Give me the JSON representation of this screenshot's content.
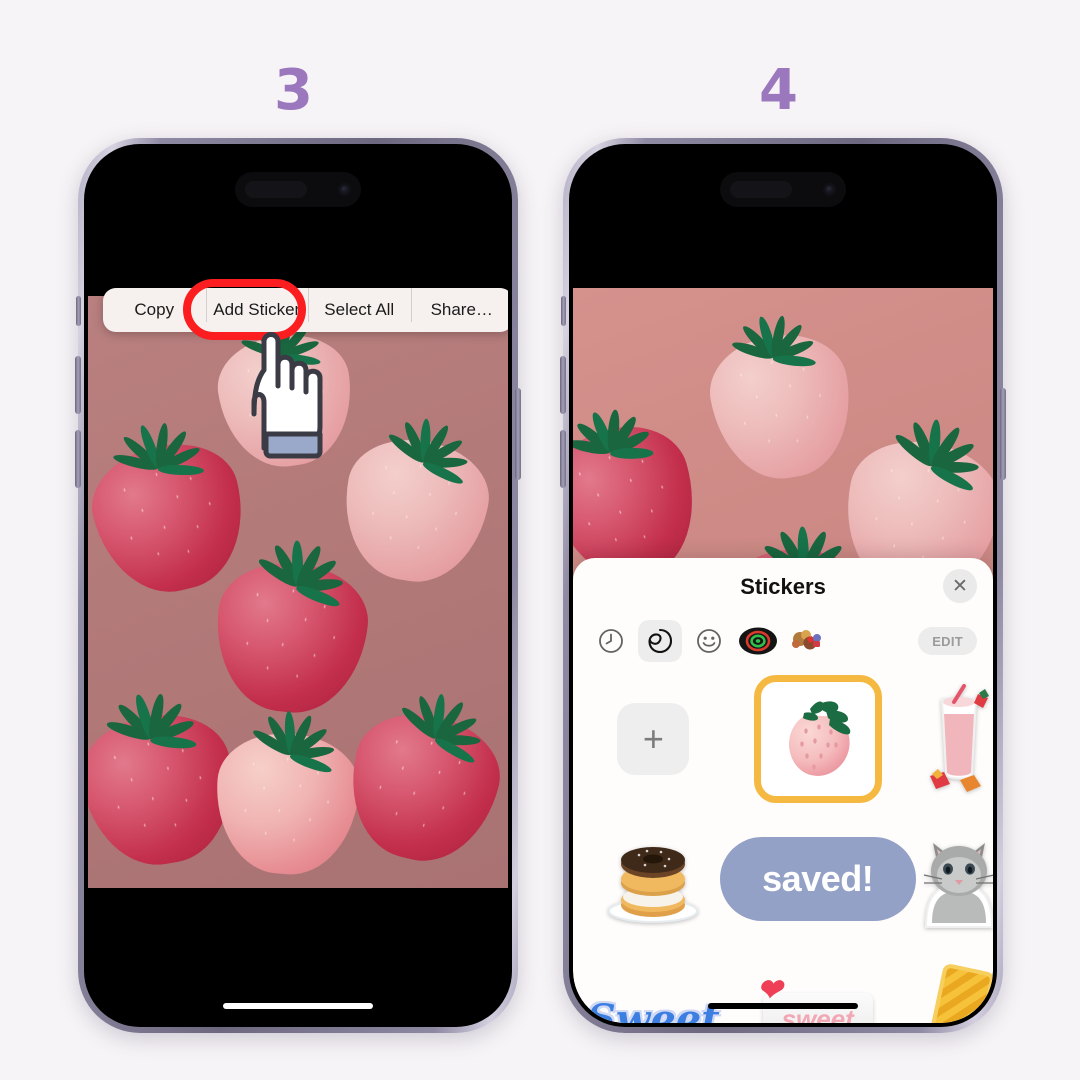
{
  "page": {
    "background_color": "#f7f4f7",
    "accent_purple": "#9b77bd"
  },
  "steps": [
    {
      "number": "3"
    },
    {
      "number": "4"
    }
  ],
  "phone_left": {
    "context_menu": {
      "items": [
        {
          "label": "Copy",
          "highlighted": false
        },
        {
          "label": "Add Sticker",
          "highlighted": true
        },
        {
          "label": "Select All",
          "highlighted": false
        },
        {
          "label": "Share…",
          "highlighted": false
        }
      ],
      "highlight_color": "#fb1d20"
    },
    "cursor": {
      "icon": "pointing-hand-icon"
    },
    "photo": {
      "subject": "strawberries",
      "background_color": "#b07877"
    }
  },
  "phone_right": {
    "photo": {
      "subject": "strawberries",
      "background_color": "#cb8884"
    },
    "stickers_panel": {
      "title": "Stickers",
      "close_label": "✕",
      "tabs": [
        {
          "name": "recents-tab",
          "icon": "clock-icon",
          "active": false
        },
        {
          "name": "stickers-tab",
          "icon": "sticker-peel-icon",
          "active": true
        },
        {
          "name": "emoji-tab",
          "icon": "smiley-icon",
          "active": false
        },
        {
          "name": "memoji-tab",
          "icon": "record-circle-icon",
          "active": false
        },
        {
          "name": "sticker-pack-tab",
          "icon": "sticker-pack-icon",
          "active": false
        }
      ],
      "edit_label": "EDIT",
      "selection_color": "#f5b942",
      "grid": [
        {
          "name": "add-sticker-cell",
          "type": "add-button",
          "label": "+"
        },
        {
          "name": "strawberry-sticker",
          "type": "sticker",
          "label": "strawberry-sticker-icon",
          "selected": true
        },
        {
          "name": "smoothie-sticker",
          "type": "sticker",
          "label": "strawberry-smoothie-sticker-icon",
          "selected": false
        },
        {
          "name": "donuts-sticker",
          "type": "sticker",
          "label": "donuts-plate-sticker-icon",
          "selected": false
        },
        {
          "name": "saved-sticker",
          "type": "text-sticker",
          "label": "saved!",
          "selected": false
        },
        {
          "name": "kitten-sticker",
          "type": "sticker",
          "label": "kitten-sticker-icon",
          "selected": false
        },
        {
          "name": "sweet-logo-sticker",
          "type": "sticker",
          "label": "Sweet",
          "selected": false
        },
        {
          "name": "sweet-sign-sticker",
          "type": "sticker",
          "label": "sweet",
          "selected": false
        },
        {
          "name": "pixel-gold-sticker",
          "type": "sticker",
          "label": "pixel-gold-bar-sticker-icon",
          "selected": false
        }
      ]
    }
  }
}
